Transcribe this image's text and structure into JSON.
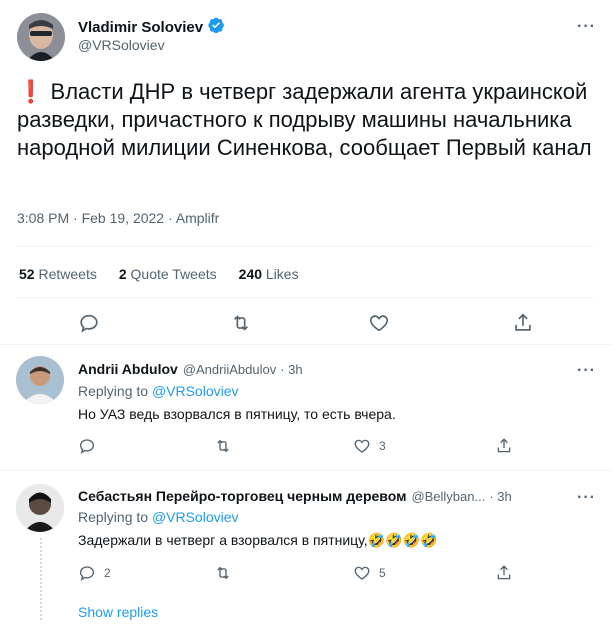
{
  "tweet": {
    "author_name": "Vladimir Soloviev",
    "author_handle": "@VRSoloviev",
    "verified": true,
    "more_icon": "more-horizontal-icon",
    "emoji": "❗",
    "text": " Власти ДНР в четверг задержали агента украинской разведки, причастного к подрыву машины начальника народной милиции Синенкова, сообщает Первый канал",
    "timestamp": "3:08 PM · Feb 19, 2022 · Amplifr",
    "stats": {
      "retweets_count": "52",
      "retweets_label": "Retweets",
      "quotes_count": "2",
      "quotes_label": "Quote Tweets",
      "likes_count": "240",
      "likes_label": "Likes"
    }
  },
  "replies": [
    {
      "author_name": "Andrii Abdulov",
      "author_handle": "@AndriiAbdulov",
      "time": "· 3h",
      "replying_to_label": "Replying to",
      "replying_to_handle": "@VRSoloviev",
      "text": "Но УАЗ ведь взорвался в пятницу, то есть вчера.",
      "reply_count": "",
      "retweet_count": "",
      "like_count": "3"
    },
    {
      "author_name": "Себастьян Перейро-торговец черным деревом",
      "author_handle": "@Bellyban...",
      "time": "· 3h",
      "replying_to_label": "Replying to",
      "replying_to_handle": "@VRSoloviev",
      "text": "Задержали в четверг а взорвался в пятницу,",
      "emojis": "🤣🤣🤣🤣",
      "reply_count": "2",
      "retweet_count": "",
      "like_count": "5"
    }
  ],
  "show_replies_label": "Show replies",
  "colors": {
    "accent": "#1d9bf0",
    "muted": "#536471",
    "text": "#0f1419",
    "alert": "#e0245e"
  }
}
